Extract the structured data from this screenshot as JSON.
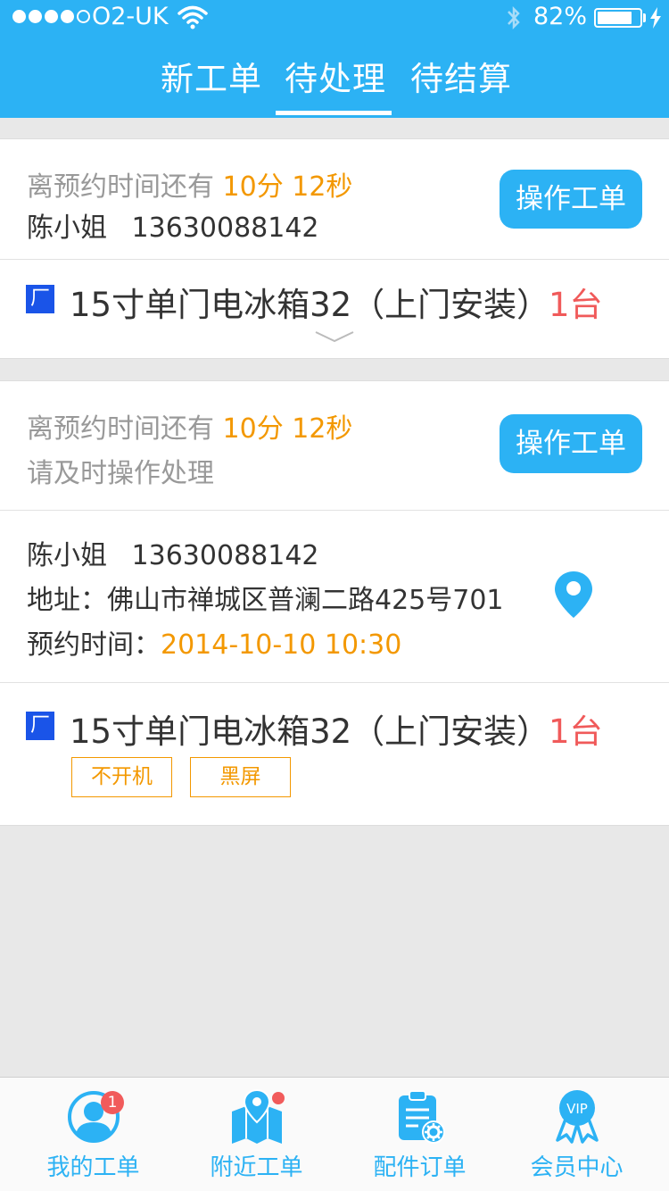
{
  "status_bar": {
    "carrier": "O2-UK",
    "battery_percent": "82%",
    "battery_level": 0.82,
    "signal_bars": 4
  },
  "tabs": [
    {
      "label": "新工单",
      "active": false
    },
    {
      "label": "待处理",
      "active": true
    },
    {
      "label": "待结算",
      "active": false
    }
  ],
  "card1": {
    "countdown_prefix": "离预约时间还有",
    "countdown_value": "10分 12秒",
    "customer": "陈小姐",
    "phone": "13630088142",
    "action_label": "操作工单",
    "factory_badge": "厂",
    "product": "15寸单门电冰箱32（上门安装）",
    "quantity": "1台"
  },
  "card2": {
    "countdown_prefix": "离预约时间还有",
    "countdown_value": "10分 12秒",
    "notice": "请及时操作处理",
    "action_label": "操作工单",
    "customer": "陈小姐",
    "phone": "13630088142",
    "address_label": "地址：",
    "address": "佛山市禅城区普澜二路425号701",
    "appointment_label": "预约时间：",
    "appointment_value": "2014-10-10  10:30",
    "factory_badge": "厂",
    "product": "15寸单门电冰箱32（上门安装）",
    "quantity": "1台",
    "tags": [
      "不开机",
      "黑屏"
    ]
  },
  "bottom_nav": [
    {
      "label": "我的工单",
      "icon": "user-icon",
      "badge": "1"
    },
    {
      "label": "附近工单",
      "icon": "map-icon",
      "dot": true
    },
    {
      "label": "配件订单",
      "icon": "clipboard-gear-icon"
    },
    {
      "label": "会员中心",
      "icon": "vip-badge-icon",
      "icon_text": "VIP"
    }
  ],
  "colors": {
    "primary": "#2cb2f4",
    "accent_orange": "#f39800",
    "quantity_red": "#f05a5a",
    "factory_blue": "#1a54e8",
    "badge_red": "#f15b5b"
  }
}
